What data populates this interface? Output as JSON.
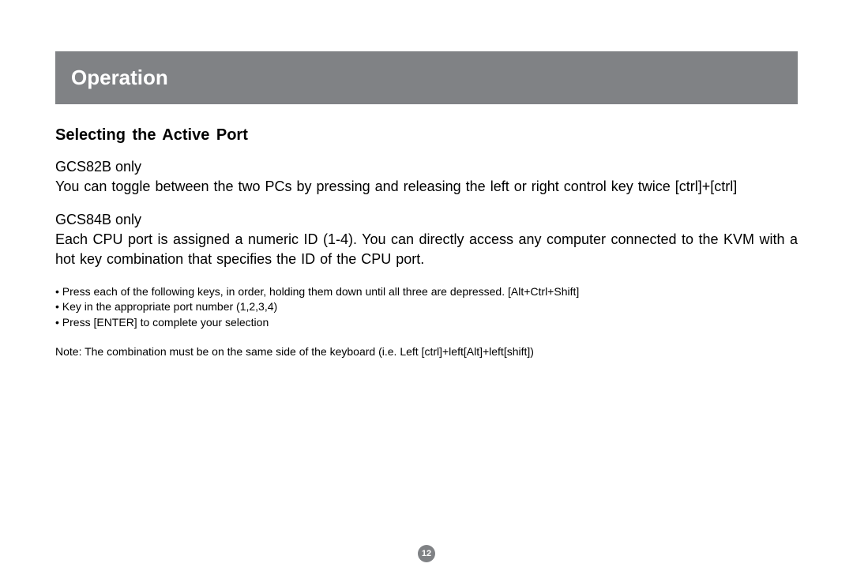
{
  "header": {
    "title": "Operation"
  },
  "section": {
    "heading": "Selecting the Active Port"
  },
  "model1": {
    "label": "GCS82B only",
    "text": "You can toggle between the two PCs by pressing and releasing the left or right control key twice [ctrl]+[ctrl]"
  },
  "model2": {
    "label": "GCS84B only",
    "text": "Each CPU port is assigned a numeric ID (1-4).  You can directly access any computer connected to the KVM with a hot key combination that specifies the ID of the CPU port."
  },
  "bullets": {
    "item1": "• Press each of the following keys, in order, holding them down until all three are depressed.  [Alt+Ctrl+Shift]",
    "item2": "• Key in the appropriate port number (1,2,3,4)",
    "item3": "• Press [ENTER] to complete your selection"
  },
  "note": "Note: The combination must be on the same side of the keyboard (i.e. Left [ctrl]+left[Alt]+left[shift])",
  "page_number": "12"
}
